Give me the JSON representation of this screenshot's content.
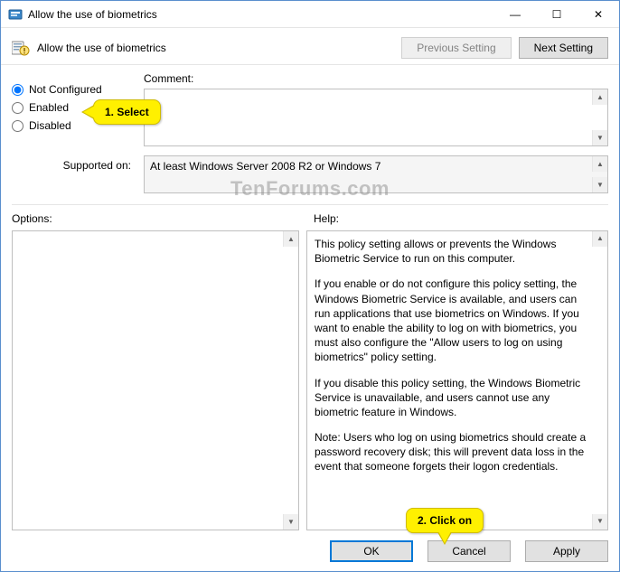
{
  "window": {
    "title": "Allow the use of biometrics",
    "minimize_glyph": "—",
    "maximize_glyph": "☐",
    "close_glyph": "✕"
  },
  "header": {
    "title": "Allow the use of biometrics",
    "prev_btn": "Previous Setting",
    "next_btn": "Next Setting"
  },
  "radios": {
    "not_configured": "Not Configured",
    "enabled": "Enabled",
    "disabled": "Disabled",
    "selected": "not_configured"
  },
  "labels": {
    "comment": "Comment:",
    "supported_on": "Supported on:",
    "options": "Options:",
    "help": "Help:"
  },
  "supported_on": "At least Windows Server 2008 R2 or Windows 7",
  "help": {
    "p1": "This policy setting allows or prevents the Windows Biometric Service to run on this computer.",
    "p2": "If you enable or do not configure this policy setting, the Windows Biometric Service is available, and users can run applications that use biometrics on Windows. If you want to enable the ability to log on with biometrics, you must also configure the \"Allow users to log on using biometrics\" policy setting.",
    "p3": "If you disable this policy setting, the Windows Biometric Service is unavailable, and users cannot use any biometric feature in Windows.",
    "p4": "Note: Users who log on using biometrics should create a password recovery disk; this will prevent data loss in the event that someone forgets their logon credentials."
  },
  "footer": {
    "ok": "OK",
    "cancel": "Cancel",
    "apply": "Apply"
  },
  "callouts": {
    "c1": "1. Select",
    "c2": "2. Click on"
  },
  "watermark": "TenForums.com"
}
